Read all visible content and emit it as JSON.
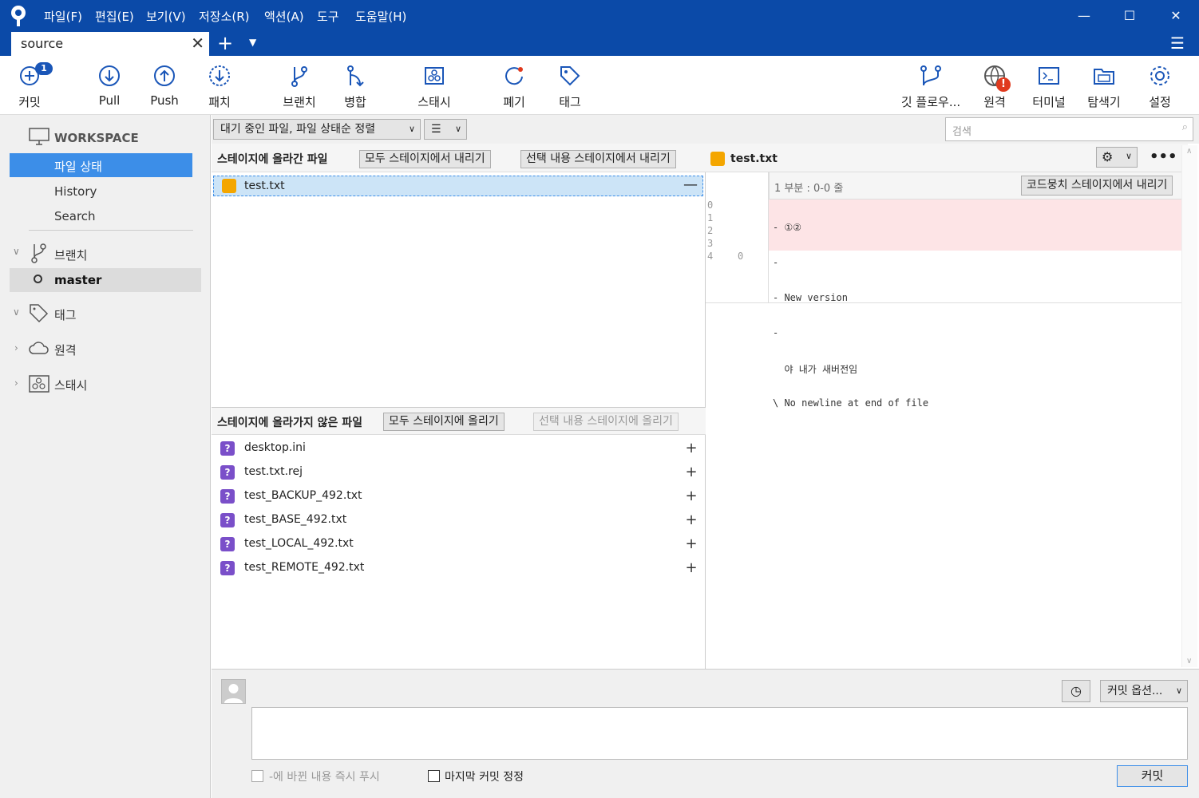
{
  "menu": [
    "파일(F)",
    "편집(E)",
    "보기(V)",
    "저장소(R)",
    "액션(A)",
    "도구",
    "도움말(H)"
  ],
  "tab": {
    "label": "source"
  },
  "toolbar": {
    "commit": "커밋",
    "commit_badge": "1",
    "pull": "Pull",
    "push": "Push",
    "patch": "패치",
    "branch": "브랜치",
    "merge": "병합",
    "stash": "스태시",
    "discard": "폐기",
    "tag": "태그",
    "gitflow": "깃 플로우...",
    "remote": "원격",
    "remote_badge": "!",
    "terminal": "터미널",
    "explorer": "탐색기",
    "settings": "설정"
  },
  "sidebar": {
    "workspace": "WORKSPACE",
    "items": [
      "파일 상태",
      "History",
      "Search"
    ],
    "branches": "브랜치",
    "branch_master": "master",
    "tags": "태그",
    "remotes": "원격",
    "stashes": "스태시"
  },
  "filter": {
    "sort": "대기 중인 파일, 파일 상태순 정렬",
    "view": "☰",
    "search_placeholder": "검색"
  },
  "staged": {
    "title": "스테이지에 올라간 파일",
    "unstage_all": "모두 스테이지에서 내리기",
    "unstage_selected": "선택 내용 스테이지에서 내리기",
    "files": [
      "test.txt"
    ]
  },
  "unstaged": {
    "title": "스테이지에 올라가지 않은 파일",
    "stage_all": "모두 스테이지에 올리기",
    "stage_selected": "선택 내용 스테이지에 올리기",
    "files": [
      "desktop.ini",
      "test.txt.rej",
      "test_BACKUP_492.txt",
      "test_BASE_492.txt",
      "test_LOCAL_492.txt",
      "test_REMOTE_492.txt"
    ]
  },
  "diff": {
    "file": "test.txt",
    "hunk_header": "1 부분 : 0-0 줄",
    "unstage_hunk": "코드뭉치 스테이지에서 내리기",
    "lines": [
      {
        "old": "0",
        "new": "",
        "text": "- ①②"
      },
      {
        "old": "1",
        "new": "",
        "text": "-"
      },
      {
        "old": "2",
        "new": "",
        "text": "- New version"
      },
      {
        "old": "3",
        "new": "",
        "text": "-"
      },
      {
        "old": "4",
        "new": "0",
        "text": "  야 내가 새버전임"
      },
      {
        "old": "",
        "new": "",
        "text": "\\ No newline at end of file"
      }
    ]
  },
  "commit": {
    "options": "커밋 옵션...",
    "push_immediately": "-에 바뀐 내용 즉시 푸시",
    "amend": "마지막 커밋 정정",
    "button": "커밋"
  },
  "colors": {
    "titlebar": "#0b4aa8",
    "selection": "#3c8ee8",
    "removed": "#fde4e6"
  }
}
